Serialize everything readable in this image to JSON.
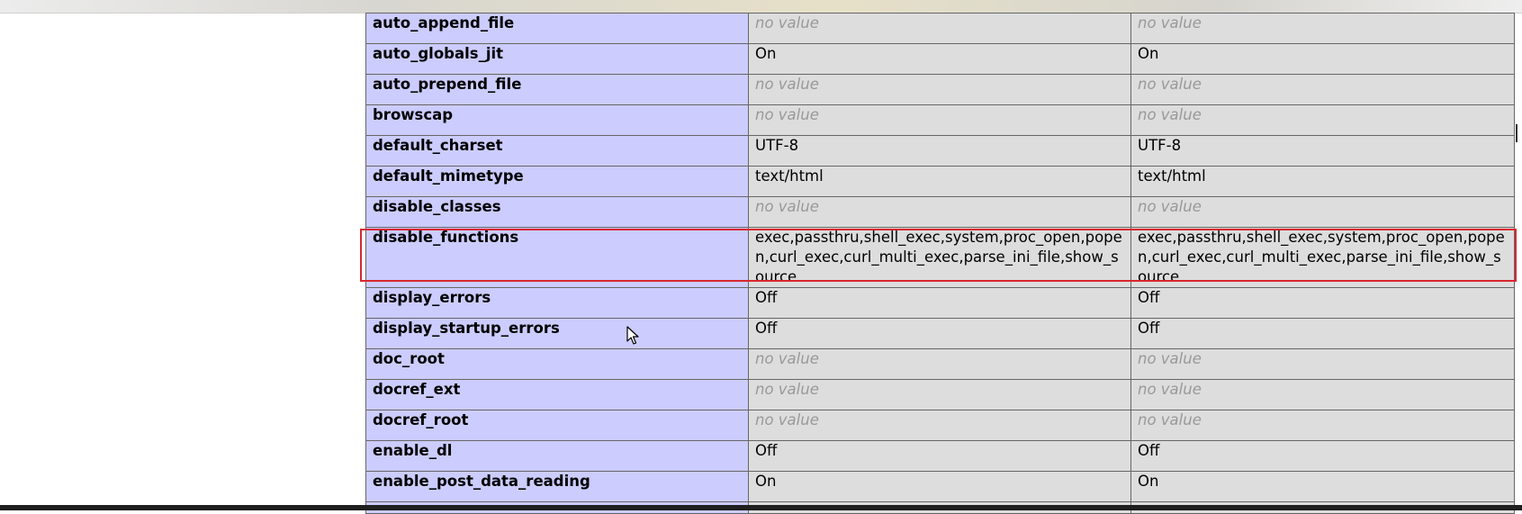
{
  "ini_directives": [
    {
      "directive": "auto_append_file",
      "local": "no value",
      "master": "no value",
      "local_no_value": true,
      "master_no_value": true
    },
    {
      "directive": "auto_globals_jit",
      "local": "On",
      "master": "On"
    },
    {
      "directive": "auto_prepend_file",
      "local": "no value",
      "master": "no value",
      "local_no_value": true,
      "master_no_value": true
    },
    {
      "directive": "browscap",
      "local": "no value",
      "master": "no value",
      "local_no_value": true,
      "master_no_value": true
    },
    {
      "directive": "default_charset",
      "local": "UTF-8",
      "master": "UTF-8"
    },
    {
      "directive": "default_mimetype",
      "local": "text/html",
      "master": "text/html"
    },
    {
      "directive": "disable_classes",
      "local": "no value",
      "master": "no value",
      "local_no_value": true,
      "master_no_value": true
    },
    {
      "directive": "disable_functions",
      "local": "exec,passthru,shell_exec,system,proc_open,popen,curl_exec,curl_multi_exec,parse_ini_file,show_source",
      "master": "exec,passthru,shell_exec,system,proc_open,popen,curl_exec,curl_multi_exec,parse_ini_file,show_source",
      "highlighted": true
    },
    {
      "directive": "display_errors",
      "local": "Off",
      "master": "Off"
    },
    {
      "directive": "display_startup_errors",
      "local": "Off",
      "master": "Off"
    },
    {
      "directive": "doc_root",
      "local": "no value",
      "master": "no value",
      "local_no_value": true,
      "master_no_value": true
    },
    {
      "directive": "docref_ext",
      "local": "no value",
      "master": "no value",
      "local_no_value": true,
      "master_no_value": true
    },
    {
      "directive": "docref_root",
      "local": "no value",
      "master": "no value",
      "local_no_value": true,
      "master_no_value": true
    },
    {
      "directive": "enable_dl",
      "local": "Off",
      "master": "Off"
    },
    {
      "directive": "enable_post_data_reading",
      "local": "On",
      "master": "On"
    }
  ],
  "colors": {
    "directive_bg": "#ccccff",
    "value_bg": "#dddddd",
    "no_value_text": "#999999",
    "highlight_border": "#d9272e",
    "border": "#666666"
  },
  "icons": {
    "cursor": "arrow-cursor-icon"
  }
}
